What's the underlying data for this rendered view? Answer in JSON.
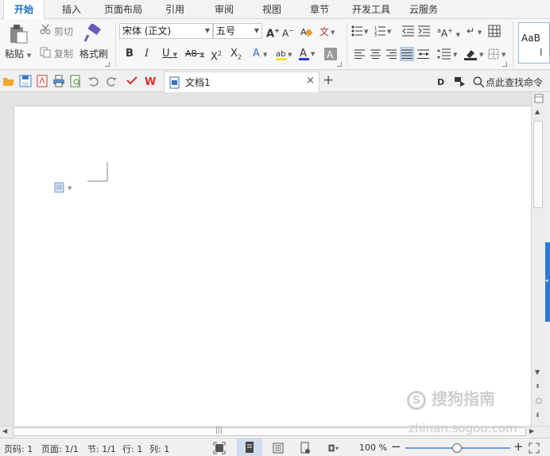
{
  "menu": {
    "tabs": [
      "开始",
      "插入",
      "页面布局",
      "引用",
      "审阅",
      "视图",
      "章节",
      "开发工具",
      "云服务"
    ],
    "active": "开始"
  },
  "ribbon": {
    "cut_label": "剪切",
    "copy_label": "复制",
    "paste_label": "粘贴",
    "format_painter_label": "格式刷",
    "font_name": "宋体 (正文)",
    "font_size": "五号",
    "style_preview": "AaB"
  },
  "qat": {
    "doc_tab_title": "文档1",
    "close_glyph": "×",
    "new_tab_glyph": "+",
    "find_command": "点此查找命令"
  },
  "status": {
    "page_num": "页码: 1",
    "pages": "页面: 1/1",
    "section": "节: 1/1",
    "line": "行: 1",
    "column": "列: 1",
    "zoom": "100 %"
  },
  "watermark": {
    "line1": "搜狗指南",
    "line2": "zhinan.sogou.com"
  },
  "colors": {
    "accent": "#1b6ec2",
    "side_tab": "#2c7ad6",
    "wps_red": "#d9302c"
  }
}
